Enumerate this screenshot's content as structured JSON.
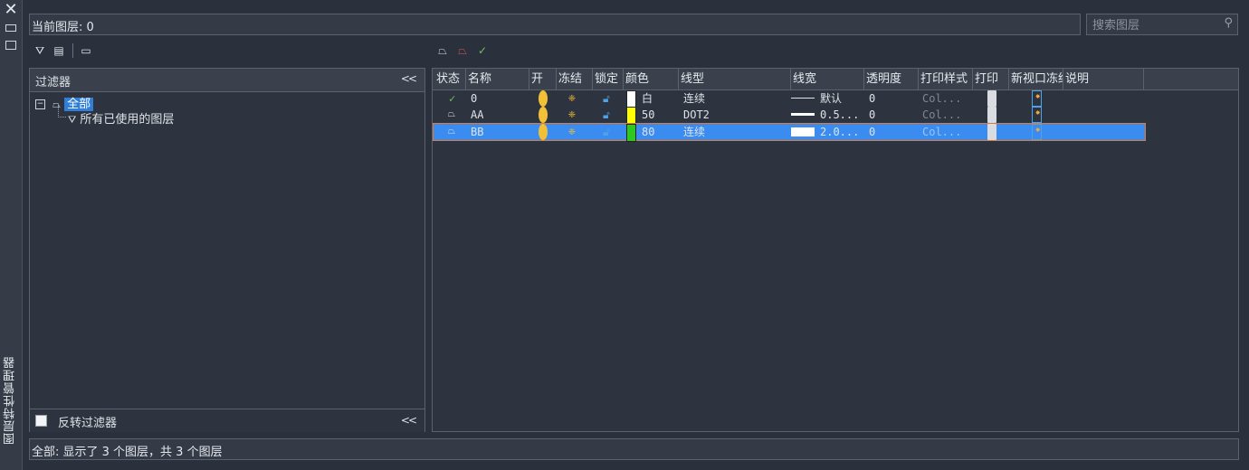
{
  "sidebar": {
    "title": "图层特性管理器",
    "close_icon": "close-icon"
  },
  "header": {
    "current_layer_label": "当前图层: 0",
    "search_placeholder": "搜索图层"
  },
  "filter_panel": {
    "title": "过滤器",
    "collapse": "<<",
    "tree": {
      "root": "全部",
      "child": "所有已使用的图层"
    },
    "invert_label": "反转过滤器",
    "invert_collapse": "<<"
  },
  "layer_table": {
    "columns": [
      "状态",
      "名称",
      "开",
      "冻结",
      "锁定",
      "颜色",
      "线型",
      "线宽",
      "透明度",
      "打印样式",
      "打印",
      "新视口冻结",
      "说明"
    ],
    "rows": [
      {
        "status": "✓",
        "name": "0",
        "color": "白",
        "swatch": "#ffffff",
        "linetype": "连续",
        "lineweight": "默认",
        "transparency": "0",
        "plotstyle": "Col...",
        "selected": false
      },
      {
        "status": "",
        "name": "AA",
        "color": "50",
        "swatch": "#ffff00",
        "linetype": "DOT2",
        "lineweight": "0.5...",
        "transparency": "0",
        "plotstyle": "Col...",
        "selected": false
      },
      {
        "status": "",
        "name": "BB",
        "color": "80",
        "swatch": "#2ec81e",
        "linetype": "连续",
        "lineweight": "2.0...",
        "transparency": "0",
        "plotstyle": "Col...",
        "selected": true
      }
    ]
  },
  "status_bar": "全部: 显示了 3 个图层，共 3 个图层"
}
